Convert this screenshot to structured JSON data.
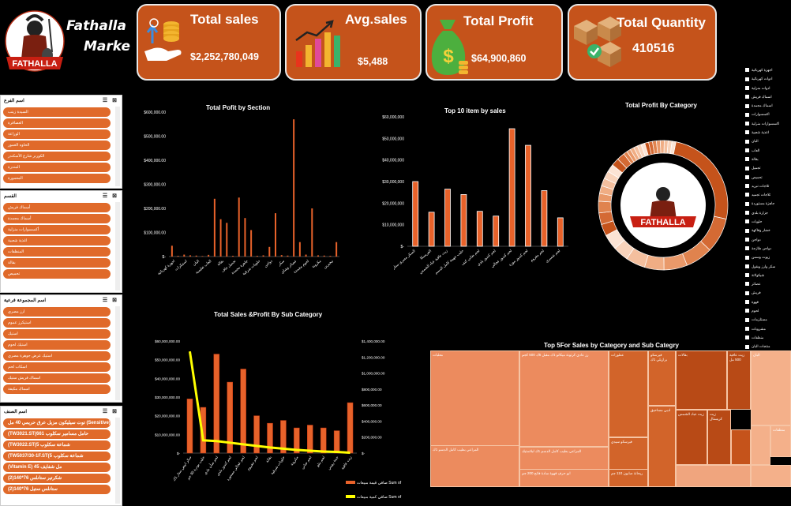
{
  "brand": {
    "line1": "Fathalla",
    "line2": "Marke",
    "logo_text": "FATHALLA"
  },
  "kpis": [
    {
      "title": "Total sales",
      "value": "$2,252,780,049",
      "icon": "hand-coins-icon"
    },
    {
      "title": "Avg.sales",
      "value": "$5,488",
      "icon": "bar-growth-icon"
    },
    {
      "title": "Total Profit",
      "value": "$64,900,860",
      "icon": "money-bag-icon"
    },
    {
      "title": "Total Quantity",
      "value": "410516",
      "icon": "boxes-check-icon"
    }
  ],
  "colors": {
    "accent": "#c5531b",
    "bar": "#e8622a",
    "line": "#ffff00",
    "slicer_item": "#e06a2a"
  },
  "slicers": [
    {
      "title": "اسم الفرع",
      "items": [
        "السيدة زينب",
        "العصافرة",
        "الوراعة",
        "الحاوه العمور",
        "الكورنر شارع الأسكندر",
        "المندرة",
        "المعمورة"
      ]
    },
    {
      "title": "القسم",
      "items": [
        "أسماك فريش",
        "أسماك مجمدة",
        "أكسسوارات منزلية",
        "اغذية شعبية",
        "المنظفات",
        "بقالة",
        "تحميص"
      ]
    },
    {
      "title": "اسم المجموعة فرعية",
      "items": [
        "ارز مصري",
        "استيكرز عموم",
        "استيك",
        "استيك لحوم",
        "استيك عرض جوهرة مصري",
        "اسكاب لحم",
        "اسماك فريش ستيك",
        "اسماك مكيفة"
      ]
    },
    {
      "title": "اسم الصنف",
      "items": [
        "توت سيليكون مزيل عرق حريمي 40 مل (Sensitive)",
        "(TW3021.ST(661 حامل مسامير سكلوب",
        "(TW3022.ST(5 شماعة سكلوب",
        "(TW5037/30-1F.ST(5 شماعة سكلوب",
        "(Vitamin E) 45 مل شفايف",
        "(2)140*76 شكرتير ستانلس",
        "(2)140*76 ستانلس ستيل"
      ]
    }
  ],
  "chart_section": {
    "title": "Total Pofit by Section",
    "yticks": [
      "$-",
      "$100,000.00",
      "$200,000.00",
      "$300,000.00",
      "$400,000.00",
      "$500,000.00",
      "$600,000.00"
    ],
    "ylim": [
      0,
      600000
    ],
    "categories": [
      "اجهزة كهربائية",
      "ادوات مدرسية",
      "استيكرات",
      "اكسسوارات",
      "العاب",
      "البان",
      "بقالة",
      "بسكويت",
      "تجميل",
      "جاهز",
      "حلويات",
      "خضار",
      "دواجن",
      "زيوت",
      "سكر",
      "شيكولاتة",
      "صابون",
      "عصائر",
      "فاكهة",
      "كيك",
      "لحوم",
      "مشروبات",
      "مكرونة",
      "مناديل",
      "منظفات",
      "مياه",
      "نيجيرين",
      "ورقيات"
    ],
    "values": [
      45000,
      3000,
      8000,
      5000,
      4000,
      2000,
      7000,
      240000,
      155000,
      140000,
      3000,
      245000,
      160000,
      110000,
      3000,
      5000,
      40000,
      180000,
      6000,
      4000,
      570000,
      60000,
      8000,
      200000,
      5000,
      4000,
      3000,
      60000
    ],
    "tick_labels": [
      "اجهزة كهربائية",
      "استيكرات",
      "البان",
      "العاب تعليمية",
      "بقالة",
      "تجميل جاف",
      "جاهزة مجمدة",
      "حلويات شرقية",
      "دواجن",
      "سكر",
      "عصائر وشاي",
      "لحوم مجمدة",
      "مكرونة",
      "نيجيرين"
    ]
  },
  "chart_top10": {
    "title": "Top 10 item by sales",
    "yticks": [
      "$-",
      "$10,000,000",
      "$20,000,000",
      "$30,000,000",
      "$40,000,000",
      "$50,000,000",
      "$60,000,000"
    ],
    "ylim": [
      0,
      60000000
    ],
    "categories": [
      "السكر مصري",
      "الفريسكا",
      "زيت عافية",
      "حليب جهينة",
      "خلطة بهارات",
      "لحم ضأن",
      "لحم كندوز",
      "لحم مفروم",
      "فراخ بانيه",
      "لحم ضاني"
    ],
    "values": [
      30000000,
      15800000,
      26500000,
      24000000,
      16200000,
      14000000,
      54500000,
      46800000,
      25800000,
      13200000
    ],
    "tick_labels": [
      "السكر مصري ستار",
      "الفريسكا",
      "زيت عافية عباد الشمس",
      "حليب جهينة كامل الدسم",
      "لحم ضاني كتف",
      "لحم كندوز بلدي",
      "لحم كندوز عجالي",
      "لحم كندوز موزة",
      "لحم مفروم",
      "لحم شمبري"
    ]
  },
  "chart_category": {
    "title": "Total Profit By Category",
    "values": [
      26,
      9,
      7,
      6,
      5,
      5,
      4,
      4,
      3,
      3,
      3,
      2,
      2,
      2,
      2,
      2,
      2,
      2,
      1,
      1,
      1,
      1,
      1,
      1,
      1,
      1,
      1,
      1,
      1,
      1,
      1,
      1
    ],
    "legend": [
      "أجهزة كهربائية",
      "أدوات كهربائية",
      "أدوات منزلية",
      "اسماك فريش",
      "اسماك مجمدة",
      "اكسسوارات",
      "اكسسوارات منزلية",
      "اغذية شعبية",
      "البان",
      "العاب",
      "بقالة",
      "تجميل",
      "تحميص",
      "ثلاجات تبريد",
      "ثلاجات تجميد",
      "جاهزة مستوردة",
      "جزارة بلدي",
      "حلويات",
      "خضار وفاكهة",
      "دواجن",
      "دواجن طازجة",
      "زيوت وسمن",
      "سكر وأرز وبقول",
      "شيكولاتة",
      "عصائر",
      "فريش",
      "قهوة",
      "لحوم",
      "مستلزمات",
      "مشروبات",
      "منظفات",
      "منتجات ألبان",
      "معلبات",
      "مياه",
      "مكرونة",
      "كيك",
      "نيجيرين",
      "ورقيات"
    ]
  },
  "chart_subcat": {
    "title": "Total Sales &Profit By Sub Category",
    "yticks_left": [
      "$-",
      "$10,000,000.00",
      "$20,000,000.00",
      "$30,000,000.00",
      "$40,000,000.00",
      "$50,000,000.00",
      "$60,000,000.00"
    ],
    "yticks_right": [
      "$-",
      "$200,000.00",
      "$400,000.00",
      "$600,000.00",
      "$800,000.00",
      "$1,000,000.00",
      "$1,200,000.00",
      "$1,400,000.00"
    ],
    "ylim_left": [
      0,
      60000000
    ],
    "ylim_right": [
      0,
      1400000
    ],
    "categories": [
      "سكر 1ك",
      "حليب بودرة",
      "لحم ضأن",
      "لحم كندوز",
      "لحم عجالي",
      "لحم مفروم",
      "فراخ",
      "مكرونة",
      "بقالة",
      "زيت",
      "لحم بتلو",
      "جبن",
      "زيت عافية"
    ],
    "sales": [
      29000000,
      24500000,
      53000000,
      38000000,
      45000000,
      20000000,
      16000000,
      17500000,
      13500000,
      15000000,
      13500000,
      12000000,
      27000000
    ],
    "quantity": [
      1270000,
      160000,
      150000,
      130000,
      110000,
      90000,
      70000,
      55000,
      40000,
      30000,
      20000,
      15000,
      5000
    ],
    "tick_labels": [
      "سكر ابيض ستار 1ك",
      "حليب بودرة 30 جم",
      "لحم ضأن بلدي",
      "لحم كندوز بلدي",
      "لحم عجالي مستورد",
      "لحم مفروم",
      "بقالة",
      "حلويات شرقية",
      "مكرونة",
      "لحم ضاني",
      "لحم بتلو",
      "جبنة رومي",
      "زيت عافية"
    ],
    "legend": [
      {
        "label": "صافي قيمة مبيعات Sum of",
        "color": "#e8622a"
      },
      {
        "label": "صافي كمية مبيعات Sum of",
        "color": "#ffff00"
      }
    ]
  },
  "treemap": {
    "title": "Top  5For Sales by Category and Sub Categry",
    "groups": [
      {
        "name": "معلبات",
        "items": [
          "رز عادي كرتونة ميكانو 1ك مقبل 5ك 500 كجم",
          "المراعي بطيب كامل الدسم 1ك لبلاستيك",
          "المراعي بطيب كامل الدسم 1ك",
          "ابو حرف قهوة سادة فاتح 200 جم",
          "التونسية تنك 250 جم"
        ]
      },
      {
        "name": "عطورات",
        "items": [
          "فيرسكو برازيلي 1ك",
          "فيرسكو سيدي",
          "ادبي مساحيق",
          "ريحانة صابون 110 جم"
        ]
      },
      {
        "name": "بقالات",
        "items": [
          "زيت عافية 500 مل",
          "زيت عباد الشمس",
          "زيت كريستال"
        ]
      },
      {
        "name": "منظفات",
        "items": [
          "برسيل",
          "اريال"
        ]
      },
      {
        "name": "البان",
        "items": []
      }
    ]
  }
}
